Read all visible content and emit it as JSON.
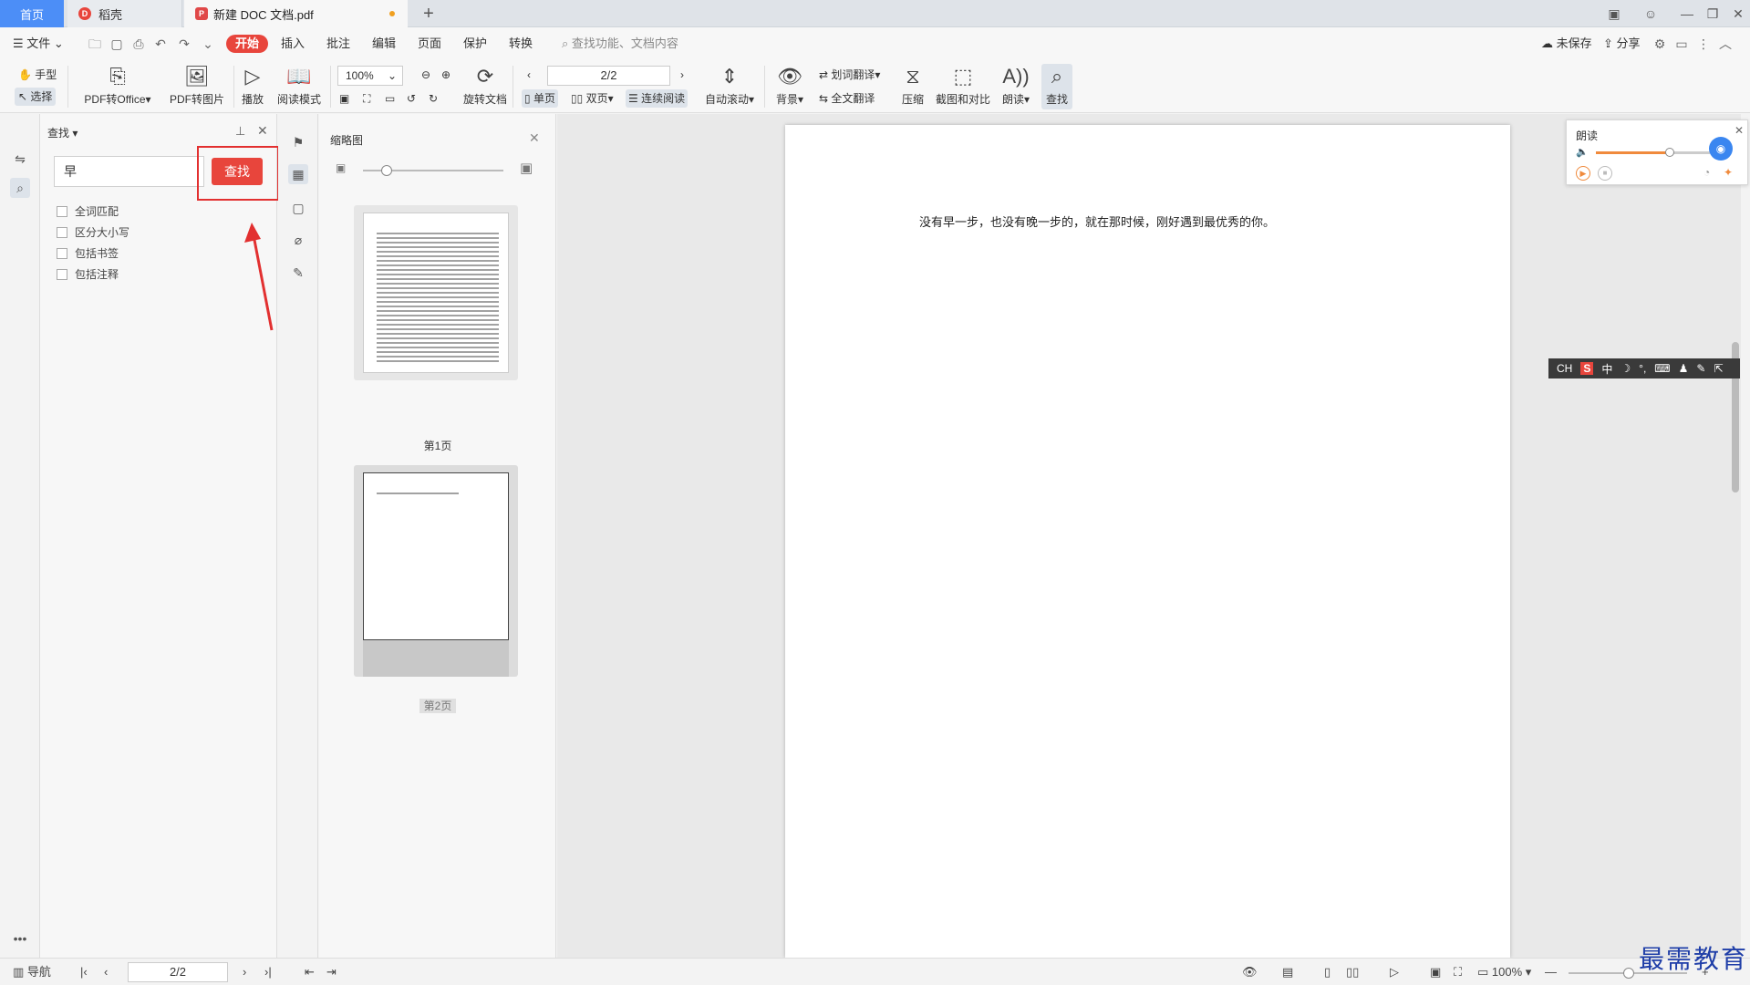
{
  "tabs": {
    "home": "首页",
    "daoke": "稻壳",
    "doc": "新建 DOC 文档.pdf",
    "add": "+"
  },
  "menu": {
    "file": "文件",
    "items": [
      "开始",
      "插入",
      "批注",
      "编辑",
      "页面",
      "保护",
      "转换"
    ],
    "search_placeholder": "查找功能、文档内容",
    "unsaved": "未保存",
    "share": "分享"
  },
  "ribbon": {
    "hand": "手型",
    "select": "选择",
    "pdf_to_office": "PDF转Office",
    "pdf_to_image": "PDF转图片",
    "play": "播放",
    "read_mode": "阅读模式",
    "zoom": "100%",
    "rotate": "旋转文档",
    "page": "2/2",
    "single": "单页",
    "double": "双页",
    "continuous": "连续阅读",
    "auto_scroll": "自动滚动",
    "background": "背景",
    "word_translate": "划词翻译",
    "full_translate": "全文翻译",
    "compress": "压缩",
    "screenshot_compare": "截图和对比",
    "read_aloud": "朗读",
    "find": "查找"
  },
  "find_panel": {
    "title": "查找",
    "query": "早",
    "button": "查找",
    "options": [
      "全词匹配",
      "区分大小写",
      "包括书签",
      "包括注释"
    ]
  },
  "thumbnails": {
    "title": "缩略图",
    "pages": [
      "第1页",
      "第2页"
    ]
  },
  "document": {
    "text": "没有早一步，也没有晚一步的，就在那时候，刚好遇到最优秀的你。"
  },
  "read_widget": {
    "title": "朗读"
  },
  "ime": {
    "lang": "CH",
    "mode": "中"
  },
  "status": {
    "nav": "导航",
    "page": "2/2",
    "zoom": "100%"
  },
  "watermark": "最需教育",
  "colors": {
    "accent": "#e8453c",
    "tab_home": "#4c8ef7",
    "annotation": "#e23030"
  }
}
